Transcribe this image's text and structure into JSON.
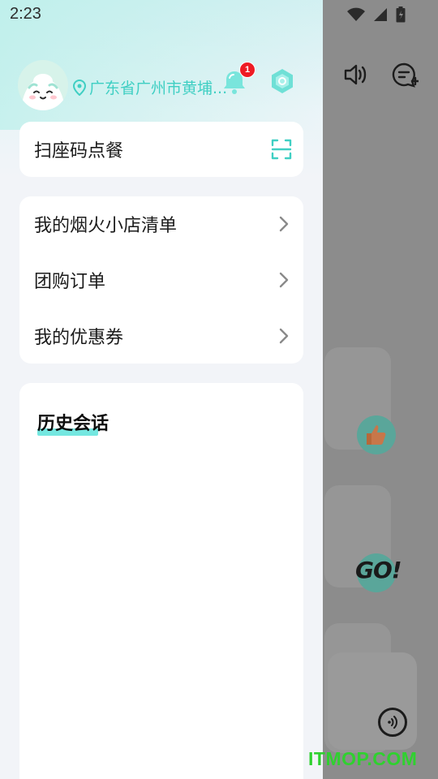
{
  "status_bar": {
    "time": "2:23"
  },
  "drawer": {
    "location": "广东省广州市黄埔...",
    "notification_count": "1",
    "scan_label": "扫座码点餐",
    "menu_items": [
      {
        "label": "我的烟火小店清单"
      },
      {
        "label": "团购订单"
      },
      {
        "label": "我的优惠券"
      }
    ],
    "history_title": "历史会话"
  },
  "background": {
    "go_sticker": "GO!"
  },
  "watermark": "ITMOP.COM",
  "colors": {
    "accent": "#3fcfc3",
    "badge": "#ee1b24",
    "highlight": "#74e7e0"
  },
  "icons": [
    "location-pin-icon",
    "bell-icon",
    "settings-icon",
    "scan-icon",
    "chevron-right-icon",
    "volume-icon",
    "chat-plus-icon",
    "voice-icon",
    "wifi-icon",
    "signal-icon",
    "battery-icon"
  ]
}
